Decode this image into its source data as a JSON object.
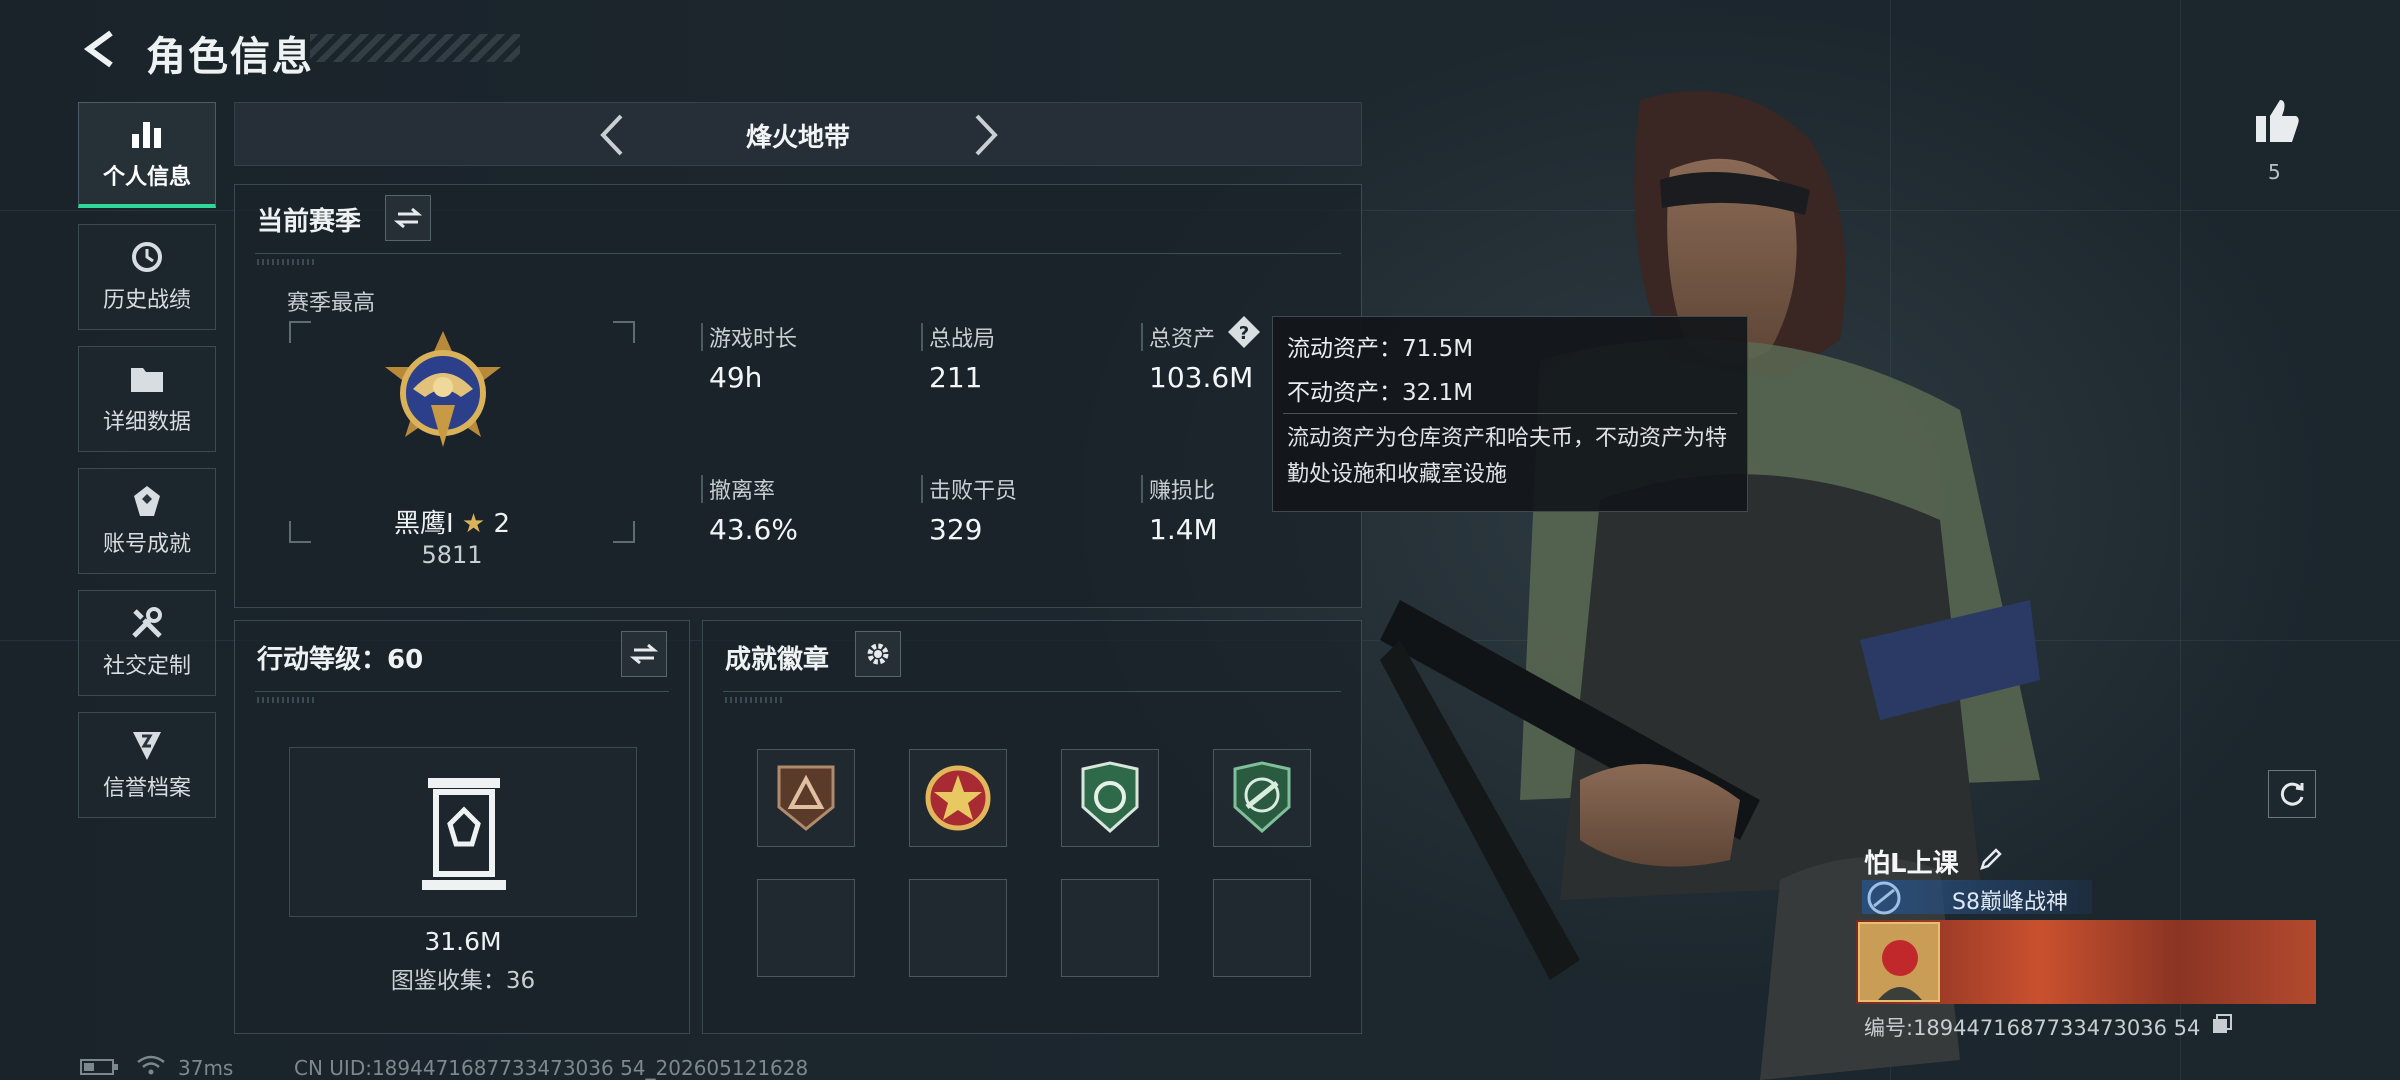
{
  "header": {
    "title": "角色信息"
  },
  "sidebar": {
    "items": [
      {
        "label": "个人信息",
        "icon": "bar-chart-icon",
        "active": true
      },
      {
        "label": "历史战绩",
        "icon": "history-icon"
      },
      {
        "label": "详细数据",
        "icon": "folder-icon"
      },
      {
        "label": "账号成就",
        "icon": "achievement-icon"
      },
      {
        "label": "社交定制",
        "icon": "tools-icon"
      },
      {
        "label": "信誉档案",
        "icon": "credit-icon"
      }
    ]
  },
  "mode_bar": {
    "title": "烽火地带"
  },
  "season": {
    "title": "当前赛季",
    "best_label": "赛季最高",
    "rank_name": "黑鹰I",
    "rank_stars": "2",
    "rank_score": "5811",
    "stats": [
      {
        "label": "游戏时长",
        "value": "49h"
      },
      {
        "label": "总战局",
        "value": "211"
      },
      {
        "label": "总资产",
        "value": "103.6M"
      },
      {
        "label": "撤离率",
        "value": "43.6%"
      },
      {
        "label": "击败干员",
        "value": "329"
      },
      {
        "label": "赚损比",
        "value": "1.4M"
      }
    ]
  },
  "tooltip": {
    "liquid": "流动资产：71.5M",
    "fixed": "不动资产：32.1M",
    "note": "流动资产为仓库资产和哈夫币，不动资产为特勤处设施和收藏室设施"
  },
  "action_level": {
    "title": "行动等级：60",
    "value": "31.6M",
    "collection": "图鉴收集：36"
  },
  "badges": {
    "title": "成就徽章"
  },
  "player": {
    "likes": "5",
    "name": "怕L上课",
    "rank_title": "S8巅峰战神",
    "id": "编号:1894471687733473036 54"
  },
  "footer": {
    "ping": "37ms",
    "uid": "CN UID:1894471687733473036 54_202605121628"
  },
  "colors": {
    "accent": "#2fd79a",
    "panel_border": "#3a4a52",
    "rank_blue": "#2a5a96"
  }
}
